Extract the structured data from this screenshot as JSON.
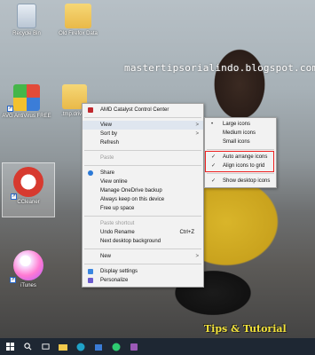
{
  "watermark": "mastertipsorialindo.blogspot.com",
  "logo_text": "Tips & Tutorial",
  "desktop_icons": [
    {
      "name": "recycle-bin-icon",
      "label": "Recycle Bin"
    },
    {
      "name": "folder-icon",
      "label": "Old Firefox Data"
    },
    {
      "name": "avg-antivirus-icon",
      "label": "AVG AntiVirus FREE"
    },
    {
      "name": "folder-icon",
      "label": ".tmp.drived"
    },
    {
      "name": "ccleaner-icon",
      "label": "CCleaner"
    },
    {
      "name": "itunes-icon",
      "label": "iTunes"
    }
  ],
  "context_menu": {
    "items": [
      {
        "label": "AMD Catalyst Control Center",
        "icon": "amd-icon"
      },
      {
        "label": "View",
        "submenu": true
      },
      {
        "label": "Sort by",
        "submenu": true
      },
      {
        "label": "Refresh"
      },
      {
        "label": "Paste",
        "disabled": true
      },
      {
        "label": "Share",
        "icon": "share-icon"
      },
      {
        "label": "View online"
      },
      {
        "label": "Manage OneDrive backup"
      },
      {
        "label": "Always keep on this device"
      },
      {
        "label": "Free up space"
      },
      {
        "label": "Paste shortcut",
        "disabled": true
      },
      {
        "label": "Undo Rename",
        "shortcut": "Ctrl+Z"
      },
      {
        "label": "Next desktop background"
      },
      {
        "label": "New",
        "submenu": true
      },
      {
        "label": "Display settings",
        "icon": "display-icon"
      },
      {
        "label": "Personalize",
        "icon": "personalize-icon"
      }
    ]
  },
  "view_submenu": {
    "items": [
      {
        "label": "Large icons",
        "mark": "•"
      },
      {
        "label": "Medium icons"
      },
      {
        "label": "Small icons"
      },
      {
        "label": "Auto arrange icons",
        "mark": "✓"
      },
      {
        "label": "Align icons to grid",
        "mark": "✓"
      },
      {
        "label": "Show desktop icons",
        "mark": "✓"
      }
    ]
  },
  "colors": {
    "highlight": "#e22222",
    "taskbar": "#1e2733",
    "menu_bg": "#f2f2f2"
  }
}
